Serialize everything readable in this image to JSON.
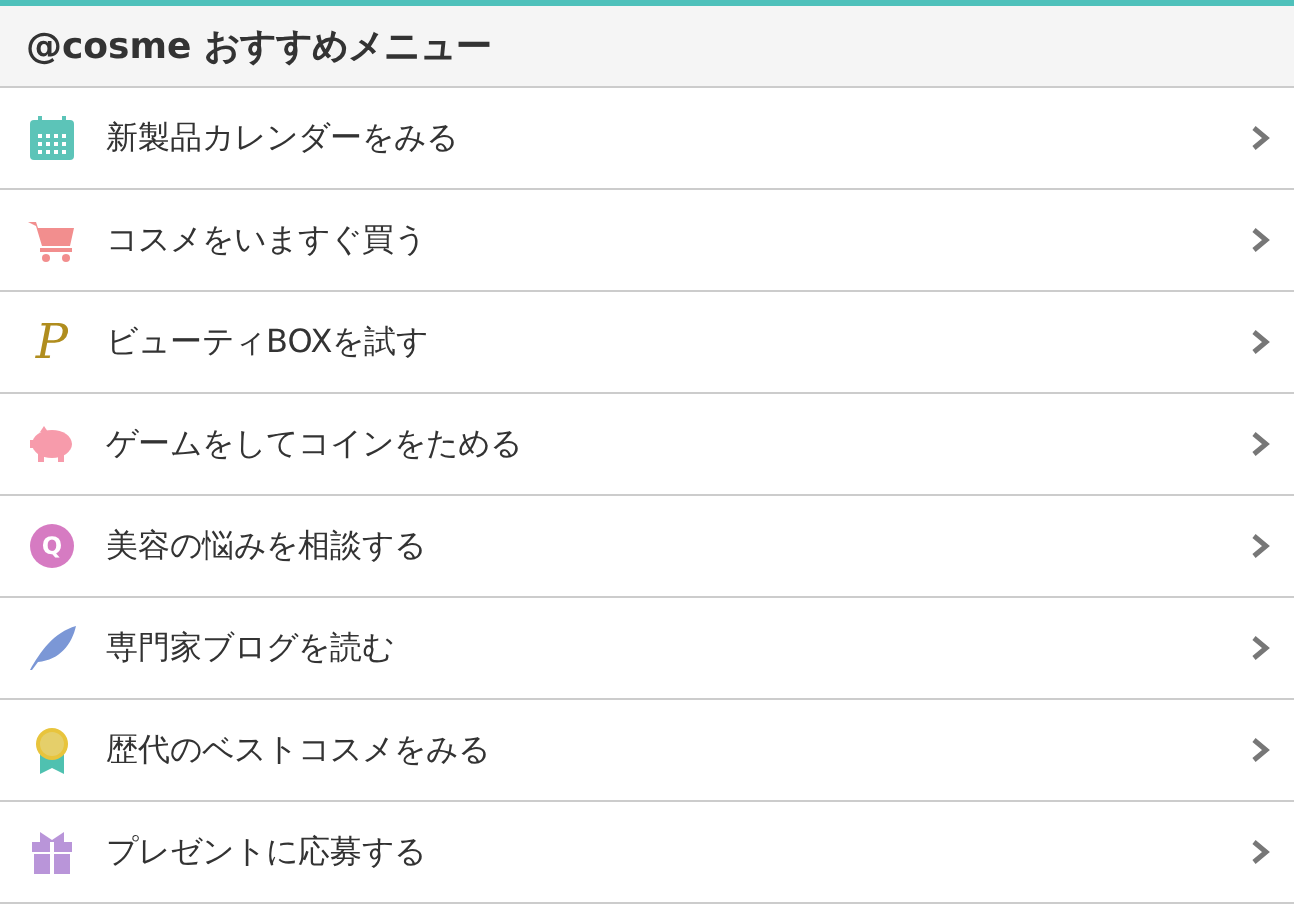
{
  "header": {
    "title": "@cosme おすすめメニュー"
  },
  "menu": [
    {
      "kind": "calendar",
      "label": "新製品カレンダーをみる"
    },
    {
      "kind": "cart",
      "label": "コスメをいますぐ買う"
    },
    {
      "kind": "letter",
      "icon_text": "P",
      "label": "ビューティBOXを試す"
    },
    {
      "kind": "piggy",
      "label": "ゲームをしてコインをためる"
    },
    {
      "kind": "badge",
      "icon_text": "Q",
      "label": "美容の悩みを相談する"
    },
    {
      "kind": "feather",
      "label": "専門家ブログを読む"
    },
    {
      "kind": "medal",
      "label": "歴代のベストコスメをみる"
    },
    {
      "kind": "gift",
      "label": "プレゼントに応募する"
    }
  ]
}
